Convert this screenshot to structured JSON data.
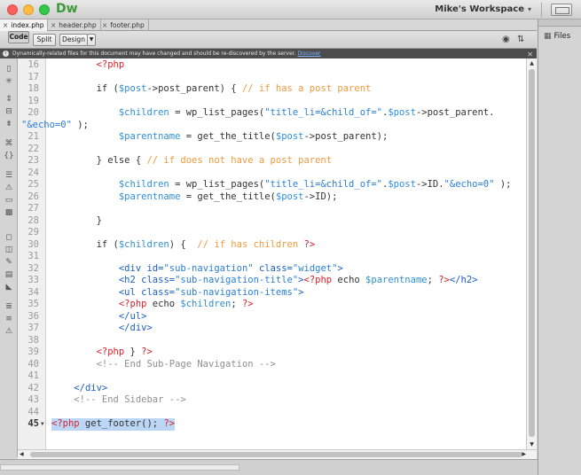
{
  "app": {
    "name": "Dw",
    "workspace": "Mike's Workspace"
  },
  "tabs": [
    {
      "label": "index.php",
      "active": true
    },
    {
      "label": "header.php",
      "active": false
    },
    {
      "label": "footer.php",
      "active": false
    }
  ],
  "viewbar": {
    "code": "Code",
    "split": "Split",
    "design": "Design"
  },
  "files_panel": {
    "label": "Files"
  },
  "infobar": {
    "message": "Dynamically-related files for this document may have changed and should be re-discovered by the server.",
    "link": "Discover"
  },
  "code_lines": [
    {
      "num": "16",
      "html": "        <span class='php'>&lt;?php</span>"
    },
    {
      "num": "17",
      "html": ""
    },
    {
      "num": "18",
      "html": "        if (<span class='var'>$post</span>-&gt;post_parent) { <span class='cmt'>// if has a post parent</span>"
    },
    {
      "num": "19",
      "html": ""
    },
    {
      "num": "20",
      "html": "            <span class='var'>$children</span> = wp_list_pages(<span class='str'>\"title_li=&amp;child_of=\"</span>.<span class='var'>$post</span>-&gt;post_parent."
    },
    {
      "num": "",
      "cont": true,
      "html": "<span class='str'>\"&amp;echo=0\"</span> );"
    },
    {
      "num": "21",
      "html": "            <span class='var'>$parentname</span> = get_the_title(<span class='var'>$post</span>-&gt;post_parent);"
    },
    {
      "num": "22",
      "html": ""
    },
    {
      "num": "23",
      "html": "        } else { <span class='cmt'>// if does not have a post parent</span>"
    },
    {
      "num": "24",
      "html": ""
    },
    {
      "num": "25",
      "html": "            <span class='var'>$children</span> = wp_list_pages(<span class='str'>\"title_li=&amp;child_of=\"</span>.<span class='var'>$post</span>-&gt;ID.<span class='str'>\"&amp;echo=0\"</span> );"
    },
    {
      "num": "26",
      "html": "            <span class='var'>$parentname</span> = get_the_title(<span class='var'>$post</span>-&gt;ID);"
    },
    {
      "num": "27",
      "html": ""
    },
    {
      "num": "28",
      "html": "        }"
    },
    {
      "num": "29",
      "html": ""
    },
    {
      "num": "30",
      "html": "        if (<span class='var'>$children</span>) {  <span class='cmt'>// if has children</span> <span class='php'>?&gt;</span>"
    },
    {
      "num": "31",
      "html": ""
    },
    {
      "num": "32",
      "html": "            <span class='html-tag'>&lt;div</span> <span class='attr'>id=</span><span class='str'>\"sub-navigation\"</span> <span class='attr'>class=</span><span class='str'>\"widget\"</span><span class='html-tag'>&gt;</span>"
    },
    {
      "num": "33",
      "html": "            <span class='html-tag'>&lt;h2</span> <span class='attr'>class=</span><span class='str'>\"sub-navigation-title\"</span><span class='html-tag'>&gt;</span><span class='php'>&lt;?php</span> echo <span class='var'>$parentname</span>; <span class='php'>?&gt;</span><span class='html-tag'>&lt;/h2&gt;</span>"
    },
    {
      "num": "34",
      "html": "            <span class='html-tag'>&lt;ul</span> <span class='attr'>class=</span><span class='str'>\"sub-navigation-items\"</span><span class='html-tag'>&gt;</span>"
    },
    {
      "num": "35",
      "html": "            <span class='php'>&lt;?php</span> echo <span class='var'>$children</span>; <span class='php'>?&gt;</span>"
    },
    {
      "num": "36",
      "html": "            <span class='html-tag'>&lt;/ul&gt;</span>"
    },
    {
      "num": "37",
      "html": "            <span class='html-tag'>&lt;/div&gt;</span>"
    },
    {
      "num": "38",
      "html": ""
    },
    {
      "num": "39",
      "html": "        <span class='php'>&lt;?php</span> } <span class='php'>?&gt;</span>"
    },
    {
      "num": "40",
      "html": "        <span class='hcmt'>&lt;!-- End Sub-Page Navigation --&gt;</span>"
    },
    {
      "num": "41",
      "html": ""
    },
    {
      "num": "42",
      "html": "    <span class='html-tag'>&lt;/div&gt;</span>"
    },
    {
      "num": "43",
      "html": "    <span class='hcmt'>&lt;!-- End Sidebar --&gt;</span>"
    },
    {
      "num": "44",
      "html": ""
    },
    {
      "num": "45",
      "current": true,
      "selected": true,
      "html": "<span class='php'>&lt;?php</span> get_footer(); <span class='php'>?&gt;</span>"
    }
  ]
}
